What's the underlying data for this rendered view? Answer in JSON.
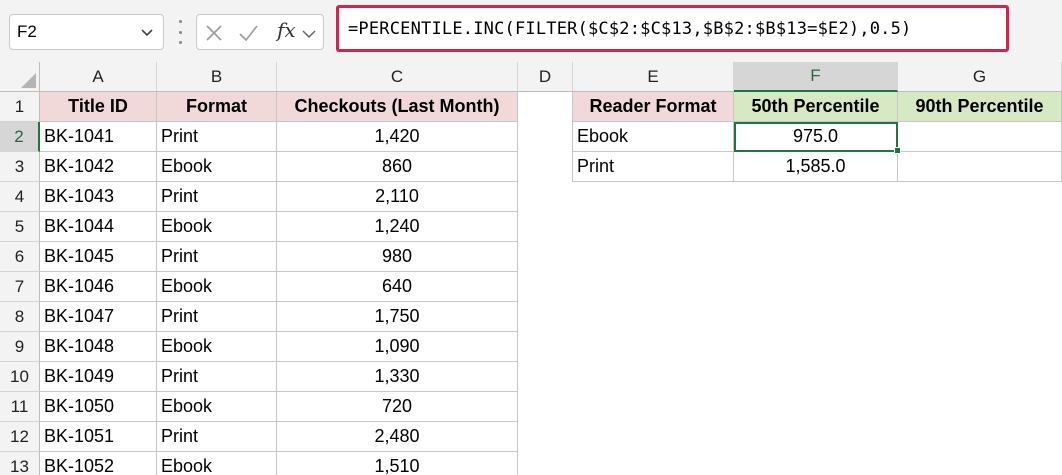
{
  "name_box": "F2",
  "formula": "=PERCENTILE.INC(FILTER($C$2:$C$13,$B$2:$B$13=$E2),0.5)",
  "fx_label": "fx",
  "columns": [
    "A",
    "B",
    "C",
    "D",
    "E",
    "F",
    "G"
  ],
  "rows": [
    "1",
    "2",
    "3",
    "4",
    "5",
    "6",
    "7",
    "8",
    "9",
    "10",
    "11",
    "12",
    "13"
  ],
  "table1": {
    "headers": [
      "Title ID",
      "Format",
      "Checkouts (Last Month)"
    ],
    "rows": [
      [
        "BK-1041",
        "Print",
        "1,420"
      ],
      [
        "BK-1042",
        "Ebook",
        "860"
      ],
      [
        "BK-1043",
        "Print",
        "2,110"
      ],
      [
        "BK-1044",
        "Ebook",
        "1,240"
      ],
      [
        "BK-1045",
        "Print",
        "980"
      ],
      [
        "BK-1046",
        "Ebook",
        "640"
      ],
      [
        "BK-1047",
        "Print",
        "1,750"
      ],
      [
        "BK-1048",
        "Ebook",
        "1,090"
      ],
      [
        "BK-1049",
        "Print",
        "1,330"
      ],
      [
        "BK-1050",
        "Ebook",
        "720"
      ],
      [
        "BK-1051",
        "Print",
        "2,480"
      ],
      [
        "BK-1052",
        "Ebook",
        "1,510"
      ]
    ]
  },
  "table2": {
    "headers": [
      "Reader Format",
      "50th Percentile",
      "90th Percentile"
    ],
    "rows": [
      [
        "Ebook",
        "975.0",
        ""
      ],
      [
        "Print",
        "1,585.0",
        ""
      ]
    ]
  },
  "selected_cell": "F2",
  "colors": {
    "accent": "#217346",
    "formula_border": "#d3244e",
    "header_pink": "#f2d9d9",
    "header_green": "#d6e8c4"
  }
}
